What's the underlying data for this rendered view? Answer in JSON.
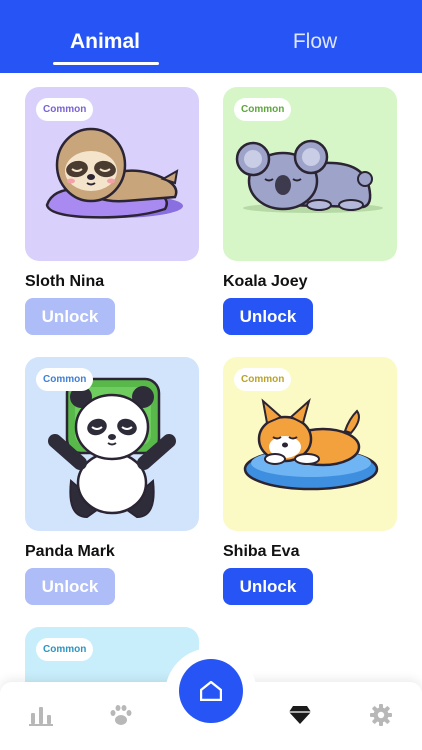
{
  "tabs": {
    "animal": "Animal",
    "flow": "Flow",
    "active": "Animal"
  },
  "cards": [
    {
      "name": "Sloth Nina",
      "badge": "Common",
      "button": "Unlock",
      "unlocked": false
    },
    {
      "name": "Koala Joey",
      "badge": "Common",
      "button": "Unlock",
      "unlocked": true
    },
    {
      "name": "Panda Mark",
      "badge": "Common",
      "button": "Unlock",
      "unlocked": false
    },
    {
      "name": "Shiba Eva",
      "badge": "Common",
      "button": "Unlock",
      "unlocked": true
    },
    {
      "badge": "Common"
    }
  ],
  "nav": {
    "items": [
      "chart-icon",
      "paw-icon",
      "home-icon",
      "diamond-icon",
      "gear-icon"
    ],
    "active": "home-icon"
  },
  "colors": {
    "primary": "#2755f5",
    "unlock_disabled": "#aebdf7",
    "nav_inactive": "#b8b8b8"
  }
}
